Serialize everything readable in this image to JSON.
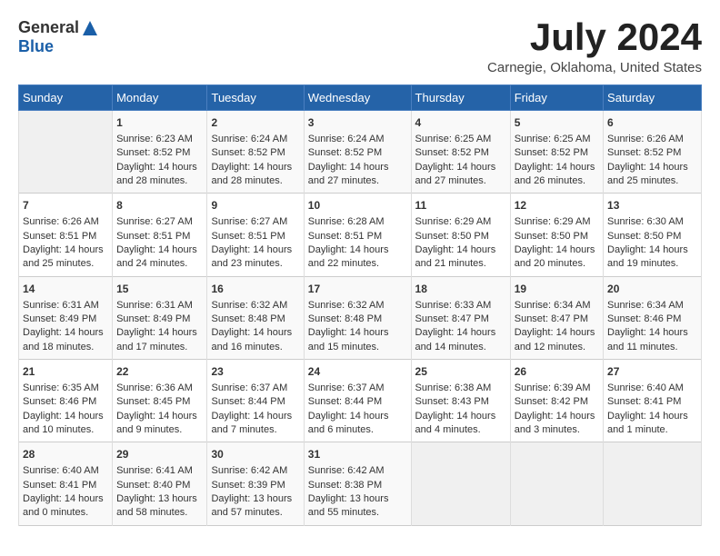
{
  "header": {
    "logo_general": "General",
    "logo_blue": "Blue",
    "month_year": "July 2024",
    "location": "Carnegie, Oklahoma, United States"
  },
  "calendar": {
    "weekdays": [
      "Sunday",
      "Monday",
      "Tuesday",
      "Wednesday",
      "Thursday",
      "Friday",
      "Saturday"
    ],
    "weeks": [
      [
        {
          "day": "",
          "empty": true
        },
        {
          "day": "1",
          "sunrise": "Sunrise: 6:23 AM",
          "sunset": "Sunset: 8:52 PM",
          "daylight": "Daylight: 14 hours and 28 minutes."
        },
        {
          "day": "2",
          "sunrise": "Sunrise: 6:24 AM",
          "sunset": "Sunset: 8:52 PM",
          "daylight": "Daylight: 14 hours and 28 minutes."
        },
        {
          "day": "3",
          "sunrise": "Sunrise: 6:24 AM",
          "sunset": "Sunset: 8:52 PM",
          "daylight": "Daylight: 14 hours and 27 minutes."
        },
        {
          "day": "4",
          "sunrise": "Sunrise: 6:25 AM",
          "sunset": "Sunset: 8:52 PM",
          "daylight": "Daylight: 14 hours and 27 minutes."
        },
        {
          "day": "5",
          "sunrise": "Sunrise: 6:25 AM",
          "sunset": "Sunset: 8:52 PM",
          "daylight": "Daylight: 14 hours and 26 minutes."
        },
        {
          "day": "6",
          "sunrise": "Sunrise: 6:26 AM",
          "sunset": "Sunset: 8:52 PM",
          "daylight": "Daylight: 14 hours and 25 minutes."
        }
      ],
      [
        {
          "day": "7",
          "sunrise": "Sunrise: 6:26 AM",
          "sunset": "Sunset: 8:51 PM",
          "daylight": "Daylight: 14 hours and 25 minutes."
        },
        {
          "day": "8",
          "sunrise": "Sunrise: 6:27 AM",
          "sunset": "Sunset: 8:51 PM",
          "daylight": "Daylight: 14 hours and 24 minutes."
        },
        {
          "day": "9",
          "sunrise": "Sunrise: 6:27 AM",
          "sunset": "Sunset: 8:51 PM",
          "daylight": "Daylight: 14 hours and 23 minutes."
        },
        {
          "day": "10",
          "sunrise": "Sunrise: 6:28 AM",
          "sunset": "Sunset: 8:51 PM",
          "daylight": "Daylight: 14 hours and 22 minutes."
        },
        {
          "day": "11",
          "sunrise": "Sunrise: 6:29 AM",
          "sunset": "Sunset: 8:50 PM",
          "daylight": "Daylight: 14 hours and 21 minutes."
        },
        {
          "day": "12",
          "sunrise": "Sunrise: 6:29 AM",
          "sunset": "Sunset: 8:50 PM",
          "daylight": "Daylight: 14 hours and 20 minutes."
        },
        {
          "day": "13",
          "sunrise": "Sunrise: 6:30 AM",
          "sunset": "Sunset: 8:50 PM",
          "daylight": "Daylight: 14 hours and 19 minutes."
        }
      ],
      [
        {
          "day": "14",
          "sunrise": "Sunrise: 6:31 AM",
          "sunset": "Sunset: 8:49 PM",
          "daylight": "Daylight: 14 hours and 18 minutes."
        },
        {
          "day": "15",
          "sunrise": "Sunrise: 6:31 AM",
          "sunset": "Sunset: 8:49 PM",
          "daylight": "Daylight: 14 hours and 17 minutes."
        },
        {
          "day": "16",
          "sunrise": "Sunrise: 6:32 AM",
          "sunset": "Sunset: 8:48 PM",
          "daylight": "Daylight: 14 hours and 16 minutes."
        },
        {
          "day": "17",
          "sunrise": "Sunrise: 6:32 AM",
          "sunset": "Sunset: 8:48 PM",
          "daylight": "Daylight: 14 hours and 15 minutes."
        },
        {
          "day": "18",
          "sunrise": "Sunrise: 6:33 AM",
          "sunset": "Sunset: 8:47 PM",
          "daylight": "Daylight: 14 hours and 14 minutes."
        },
        {
          "day": "19",
          "sunrise": "Sunrise: 6:34 AM",
          "sunset": "Sunset: 8:47 PM",
          "daylight": "Daylight: 14 hours and 12 minutes."
        },
        {
          "day": "20",
          "sunrise": "Sunrise: 6:34 AM",
          "sunset": "Sunset: 8:46 PM",
          "daylight": "Daylight: 14 hours and 11 minutes."
        }
      ],
      [
        {
          "day": "21",
          "sunrise": "Sunrise: 6:35 AM",
          "sunset": "Sunset: 8:46 PM",
          "daylight": "Daylight: 14 hours and 10 minutes."
        },
        {
          "day": "22",
          "sunrise": "Sunrise: 6:36 AM",
          "sunset": "Sunset: 8:45 PM",
          "daylight": "Daylight: 14 hours and 9 minutes."
        },
        {
          "day": "23",
          "sunrise": "Sunrise: 6:37 AM",
          "sunset": "Sunset: 8:44 PM",
          "daylight": "Daylight: 14 hours and 7 minutes."
        },
        {
          "day": "24",
          "sunrise": "Sunrise: 6:37 AM",
          "sunset": "Sunset: 8:44 PM",
          "daylight": "Daylight: 14 hours and 6 minutes."
        },
        {
          "day": "25",
          "sunrise": "Sunrise: 6:38 AM",
          "sunset": "Sunset: 8:43 PM",
          "daylight": "Daylight: 14 hours and 4 minutes."
        },
        {
          "day": "26",
          "sunrise": "Sunrise: 6:39 AM",
          "sunset": "Sunset: 8:42 PM",
          "daylight": "Daylight: 14 hours and 3 minutes."
        },
        {
          "day": "27",
          "sunrise": "Sunrise: 6:40 AM",
          "sunset": "Sunset: 8:41 PM",
          "daylight": "Daylight: 14 hours and 1 minute."
        }
      ],
      [
        {
          "day": "28",
          "sunrise": "Sunrise: 6:40 AM",
          "sunset": "Sunset: 8:41 PM",
          "daylight": "Daylight: 14 hours and 0 minutes."
        },
        {
          "day": "29",
          "sunrise": "Sunrise: 6:41 AM",
          "sunset": "Sunset: 8:40 PM",
          "daylight": "Daylight: 13 hours and 58 minutes."
        },
        {
          "day": "30",
          "sunrise": "Sunrise: 6:42 AM",
          "sunset": "Sunset: 8:39 PM",
          "daylight": "Daylight: 13 hours and 57 minutes."
        },
        {
          "day": "31",
          "sunrise": "Sunrise: 6:42 AM",
          "sunset": "Sunset: 8:38 PM",
          "daylight": "Daylight: 13 hours and 55 minutes."
        },
        {
          "day": "",
          "empty": true
        },
        {
          "day": "",
          "empty": true
        },
        {
          "day": "",
          "empty": true
        }
      ]
    ]
  }
}
